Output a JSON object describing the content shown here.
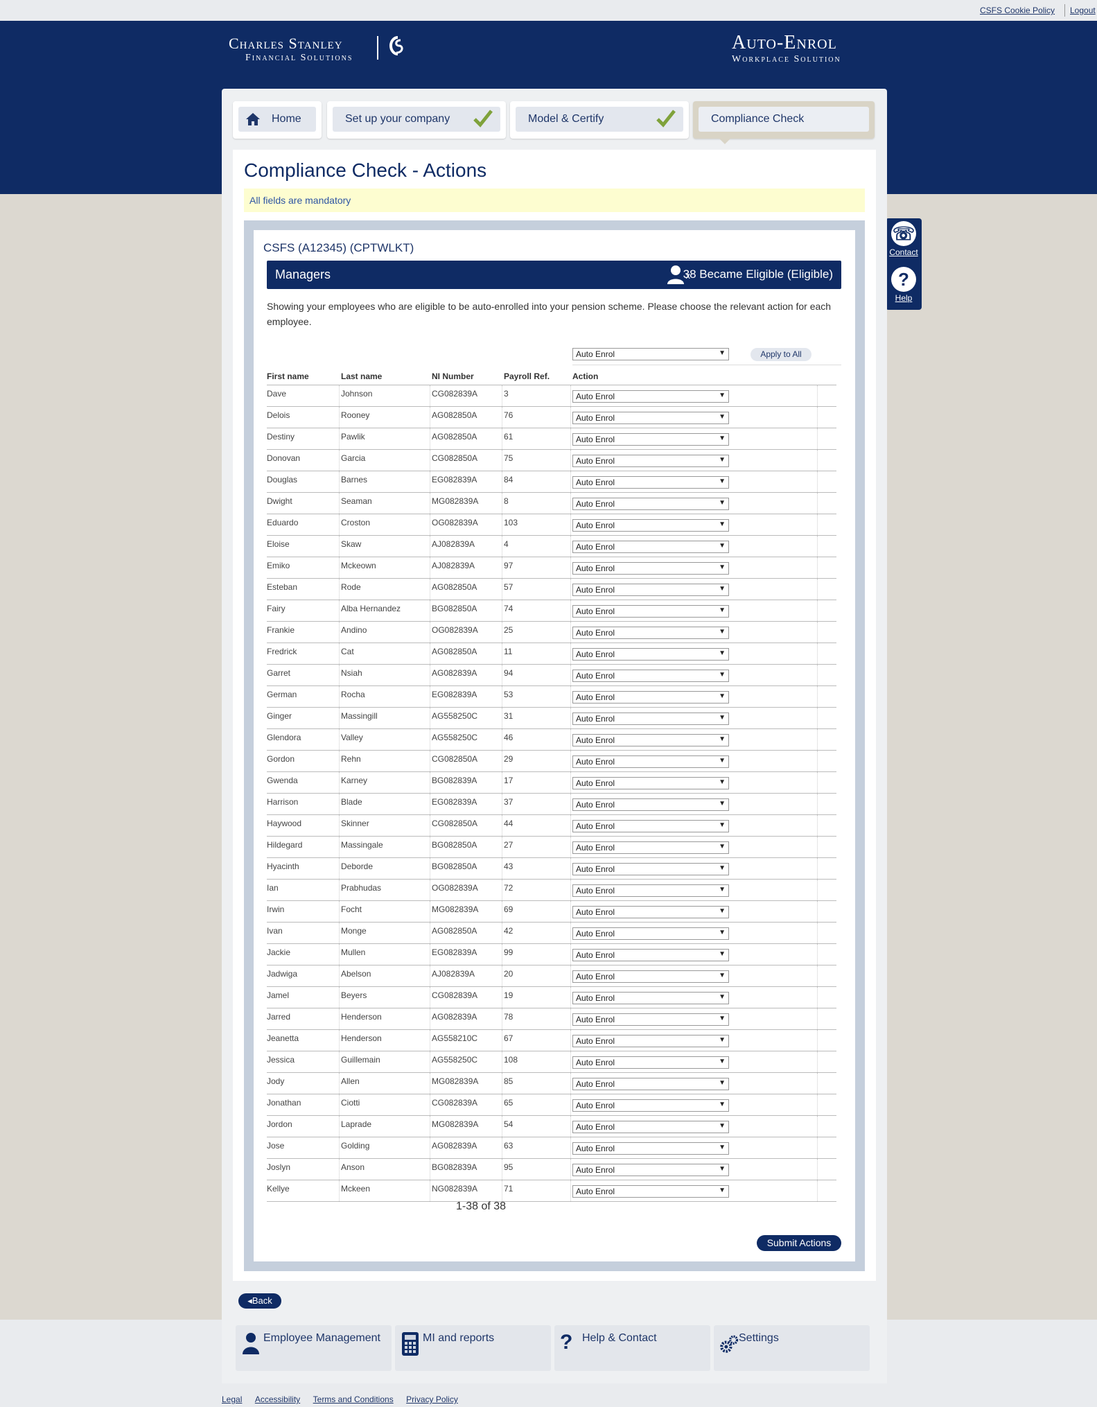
{
  "util": {
    "cookie_policy": "CSFS Cookie Policy",
    "logout": "Logout"
  },
  "brand": {
    "left_line1": "Charles Stanley",
    "left_line2": "Financial Solutions",
    "right_line1": "Auto-Enrol",
    "right_line2": "Workplace Solution"
  },
  "tabs": [
    {
      "label": "Home",
      "icon": "home-icon"
    },
    {
      "label": "Set up your company",
      "icon": "checkmark-icon",
      "complete": true
    },
    {
      "label": "Model & Certify",
      "icon": "checkmark-icon",
      "complete": true
    },
    {
      "label": "Compliance Check",
      "active": true
    }
  ],
  "page": {
    "title": "Compliance Check - Actions",
    "mandatory": "All fields are mandatory",
    "company": "CSFS (A12345) (CPTWLKT)",
    "group_title": "Managers",
    "group_multiplier": "x",
    "group_count": "38 Became Eligible (Eligible)",
    "description": "Showing your employees who are eligible to be auto-enrolled into your pension scheme. Please choose the relevant action for each employee.",
    "bulk_action": "Auto Enrol",
    "apply_all": "Apply to All",
    "pager": "1-38 of 38",
    "submit": "Submit Actions",
    "back": "Back"
  },
  "table": {
    "headers": {
      "first": "First name",
      "last": "Last name",
      "ni": "NI Number",
      "payroll": "Payroll Ref.",
      "action": "Action"
    },
    "rows": [
      [
        "Dave",
        "Johnson",
        "CG082839A",
        "3",
        "Auto Enrol"
      ],
      [
        "Delois",
        "Rooney",
        "AG082850A",
        "76",
        "Auto Enrol"
      ],
      [
        "Destiny",
        "Pawlik",
        "AG082850A",
        "61",
        "Auto Enrol"
      ],
      [
        "Donovan",
        "Garcia",
        "CG082850A",
        "75",
        "Auto Enrol"
      ],
      [
        "Douglas",
        "Barnes",
        "EG082839A",
        "84",
        "Auto Enrol"
      ],
      [
        "Dwight",
        "Seaman",
        "MG082839A",
        "8",
        "Auto Enrol"
      ],
      [
        "Eduardo",
        "Croston",
        "OG082839A",
        "103",
        "Auto Enrol"
      ],
      [
        "Eloise",
        "Skaw",
        "AJ082839A",
        "4",
        "Auto Enrol"
      ],
      [
        "Emiko",
        "Mckeown",
        "AJ082839A",
        "97",
        "Auto Enrol"
      ],
      [
        "Esteban",
        "Rode",
        "AG082850A",
        "57",
        "Auto Enrol"
      ],
      [
        "Fairy",
        "Alba Hernandez",
        "BG082850A",
        "74",
        "Auto Enrol"
      ],
      [
        "Frankie",
        "Andino",
        "OG082839A",
        "25",
        "Auto Enrol"
      ],
      [
        "Fredrick",
        "Cat",
        "AG082850A",
        "11",
        "Auto Enrol"
      ],
      [
        "Garret",
        "Nsiah",
        "AG082839A",
        "94",
        "Auto Enrol"
      ],
      [
        "German",
        "Rocha",
        "EG082839A",
        "53",
        "Auto Enrol"
      ],
      [
        "Ginger",
        "Massingill",
        "AG558250C",
        "31",
        "Auto Enrol"
      ],
      [
        "Glendora",
        "Valley",
        "AG558250C",
        "46",
        "Auto Enrol"
      ],
      [
        "Gordon",
        "Rehn",
        "CG082850A",
        "29",
        "Auto Enrol"
      ],
      [
        "Gwenda",
        "Karney",
        "BG082839A",
        "17",
        "Auto Enrol"
      ],
      [
        "Harrison",
        "Blade",
        "EG082839A",
        "37",
        "Auto Enrol"
      ],
      [
        "Haywood",
        "Skinner",
        "CG082850A",
        "44",
        "Auto Enrol"
      ],
      [
        "Hildegard",
        "Massingale",
        "BG082850A",
        "27",
        "Auto Enrol"
      ],
      [
        "Hyacinth",
        "Deborde",
        "BG082850A",
        "43",
        "Auto Enrol"
      ],
      [
        "Ian",
        "Prabhudas",
        "OG082839A",
        "72",
        "Auto Enrol"
      ],
      [
        "Irwin",
        "Focht",
        "MG082839A",
        "69",
        "Auto Enrol"
      ],
      [
        "Ivan",
        "Monge",
        "AG082850A",
        "42",
        "Auto Enrol"
      ],
      [
        "Jackie",
        "Mullen",
        "EG082839A",
        "99",
        "Auto Enrol"
      ],
      [
        "Jadwiga",
        "Abelson",
        "AJ082839A",
        "20",
        "Auto Enrol"
      ],
      [
        "Jamel",
        "Beyers",
        "CG082839A",
        "19",
        "Auto Enrol"
      ],
      [
        "Jarred",
        "Henderson",
        "AG082839A",
        "78",
        "Auto Enrol"
      ],
      [
        "Jeanetta",
        "Henderson",
        "AG558210C",
        "67",
        "Auto Enrol"
      ],
      [
        "Jessica",
        "Guillemain",
        "AG558250C",
        "108",
        "Auto Enrol"
      ],
      [
        "Jody",
        "Allen",
        "MG082839A",
        "85",
        "Auto Enrol"
      ],
      [
        "Jonathan",
        "Ciotti",
        "CG082839A",
        "65",
        "Auto Enrol"
      ],
      [
        "Jordon",
        "Laprade",
        "MG082839A",
        "54",
        "Auto Enrol"
      ],
      [
        "Jose",
        "Golding",
        "AG082839A",
        "63",
        "Auto Enrol"
      ],
      [
        "Joslyn",
        "Anson",
        "BG082839A",
        "95",
        "Auto Enrol"
      ],
      [
        "Kellye",
        "Mckeen",
        "NG082839A",
        "71",
        "Auto Enrol"
      ]
    ]
  },
  "bottom_nav": [
    {
      "label": "Employee Management",
      "icon": "person-icon"
    },
    {
      "label": "MI and reports",
      "icon": "calculator-icon"
    },
    {
      "label": "Help & Contact",
      "icon": "question-icon"
    },
    {
      "label": "Settings",
      "icon": "gears-icon"
    }
  ],
  "footer": [
    "Legal",
    "Accessibility",
    "Terms and Conditions",
    "Privacy Policy"
  ],
  "side": {
    "contact": "Contact",
    "help": "Help"
  },
  "colors": {
    "brand_navy": "#0f2b64",
    "check_green": "#7fa23b",
    "mandatory_bg": "#fdfdd0"
  }
}
